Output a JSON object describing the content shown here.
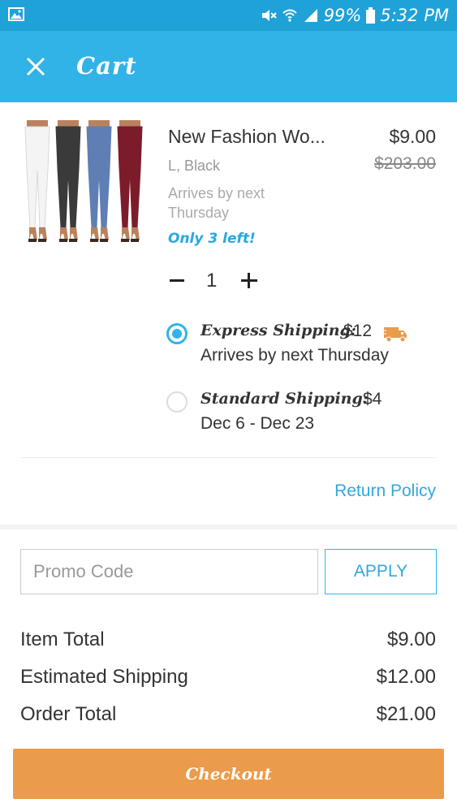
{
  "status_bar": {
    "battery": "99%",
    "time": "5:32 PM"
  },
  "header": {
    "title": "Cart",
    "close_icon": "close-icon"
  },
  "product": {
    "name": "New Fashion Wo...",
    "price": "$9.00",
    "original_price": "$203.00",
    "variant": "L, Black",
    "arrives": "Arrives by next Thursday",
    "stock": "Only 3 left!",
    "quantity": "1",
    "pants_colors": [
      "#f4f4f4",
      "#3a3a3a",
      "#5f7fb4",
      "#7c1c2a"
    ]
  },
  "shipping": {
    "express": {
      "label": "Express Shipping:",
      "cost": "$12",
      "sub": "Arrives by next Thursday",
      "selected": true,
      "icon": "truck-icon"
    },
    "standard": {
      "label": "Standard Shipping:",
      "cost": "$4",
      "sub": "Dec 6 - Dec 23",
      "selected": false
    }
  },
  "return_policy": "Return Policy",
  "promo": {
    "placeholder": "Promo Code",
    "value": "",
    "apply_label": "APPLY"
  },
  "summary": {
    "item_total_label": "Item Total",
    "item_total": "$9.00",
    "shipping_label": "Estimated Shipping",
    "shipping": "$12.00",
    "order_total_label": "Order Total",
    "order_total": "$21.00"
  },
  "checkout_label": "Checkout",
  "colors": {
    "status_bar": "#1ea2d8",
    "app_bar": "#31b3e8",
    "accent": "#31a8df",
    "checkout": "#eb9b4c"
  }
}
